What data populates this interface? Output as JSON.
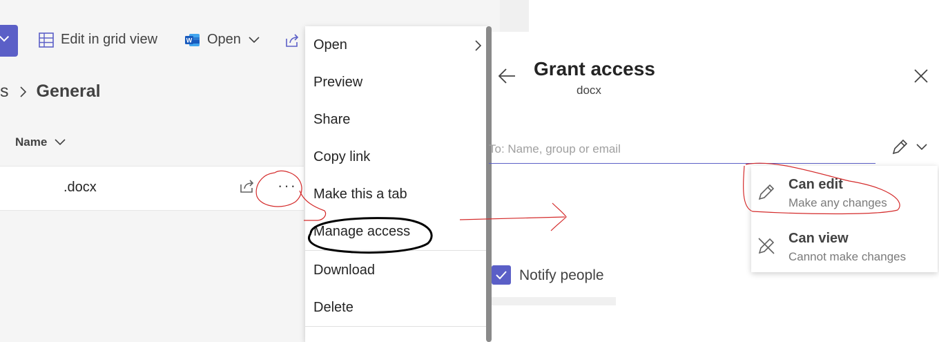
{
  "toolbar": {
    "edit_grid_label": "Edit in grid view",
    "open_label": "Open"
  },
  "breadcrumb": {
    "prev_fragment": "s",
    "current": "General"
  },
  "list": {
    "name_header": "Name",
    "file_name": ".docx"
  },
  "context_menu": {
    "items": [
      "Open",
      "Preview",
      "Share",
      "Copy link",
      "Make this a tab",
      "Manage access",
      "Download",
      "Delete"
    ]
  },
  "grant_access": {
    "title": "Grant access",
    "subtitle": "docx",
    "to_placeholder": "To: Name, group or email",
    "notify_label": "Notify people"
  },
  "permissions": {
    "can_edit_title": "Can edit",
    "can_edit_desc": "Make any changes",
    "can_view_title": "Can view",
    "can_view_desc": "Cannot make changes"
  },
  "colors": {
    "accent": "#5b5fc7",
    "annotation_red": "#d42a2a",
    "annotation_black": "#000000"
  }
}
